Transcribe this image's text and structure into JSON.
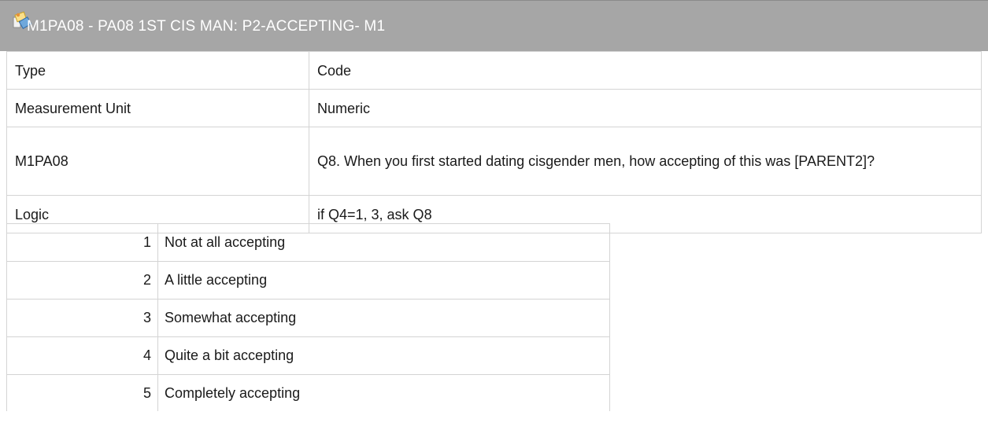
{
  "header": {
    "title": "M1PA08 - PA08 1ST CIS MAN: P2-ACCEPTING- M1",
    "icon": "variable-icon"
  },
  "properties": [
    {
      "label": "Type",
      "value": "Code"
    },
    {
      "label": "Measurement Unit",
      "value": "Numeric"
    },
    {
      "label": "M1PA08",
      "value": "Q8. When you first started dating cisgender men, how accepting of this was [PARENT2]?"
    },
    {
      "label": "Logic",
      "value": "if Q4=1, 3, ask Q8"
    }
  ],
  "codes": [
    {
      "code": "1",
      "label": "Not at all accepting"
    },
    {
      "code": "2",
      "label": "A little accepting"
    },
    {
      "code": "3",
      "label": "Somewhat accepting"
    },
    {
      "code": "4",
      "label": "Quite a bit accepting"
    },
    {
      "code": "5",
      "label": "Completely accepting"
    }
  ]
}
